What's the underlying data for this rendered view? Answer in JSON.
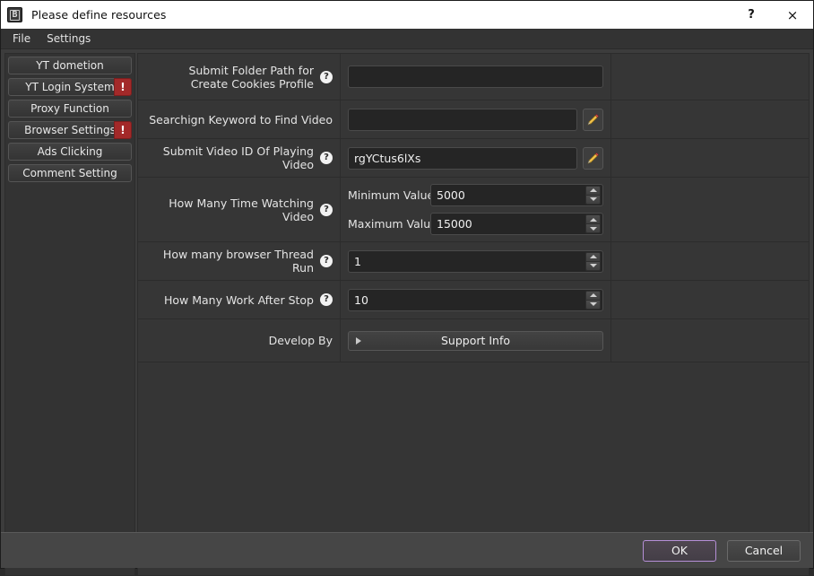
{
  "window": {
    "title": "Please define resources",
    "icon": "app-icon",
    "help_label": "?",
    "close_label": "×"
  },
  "menubar": {
    "items": [
      {
        "label": "File"
      },
      {
        "label": "Settings"
      }
    ]
  },
  "sidebar": {
    "items": [
      {
        "label": "YT dometion",
        "badge": ""
      },
      {
        "label": "YT Login System",
        "badge": "!"
      },
      {
        "label": "Proxy Function",
        "badge": ""
      },
      {
        "label": "Browser Settings",
        "badge": "!"
      },
      {
        "label": "Ads Clicking",
        "badge": ""
      },
      {
        "label": "Comment Setting",
        "badge": ""
      }
    ]
  },
  "form": {
    "rows": [
      {
        "label": "Submit Folder Path for Create Cookies Profile",
        "has_help": true,
        "value": "",
        "placeholder": "",
        "has_pencil": false
      },
      {
        "label": "Searchign Keyword to Find Video",
        "has_help": false,
        "value": "",
        "placeholder": "",
        "has_pencil": true
      },
      {
        "label": "Submit Video ID Of Playing Video",
        "has_help": true,
        "value": "rgYCtus6lXs",
        "placeholder": "",
        "has_pencil": true
      }
    ],
    "watch_time": {
      "label": "How Many Time Watching Video",
      "has_help": true,
      "min_label": "Minimum Value",
      "min_value": "5000",
      "max_label": "Maximum Value",
      "max_value": "15000"
    },
    "thread_run": {
      "label": "How many browser Thread Run",
      "has_help": true,
      "value": "1"
    },
    "work_after_stop": {
      "label": "How Many Work After Stop",
      "has_help": true,
      "value": "10"
    },
    "develop_by": {
      "label": "Develop By",
      "has_help": false,
      "button_label": "Support Info"
    }
  },
  "footer": {
    "ok_label": "OK",
    "cancel_label": "Cancel"
  },
  "colors": {
    "accent": "#b58fd6",
    "warning_badge": "#a32929",
    "window_bg": "#3c3c3c",
    "panel_bg": "#353535",
    "input_bg": "#252525",
    "titlebar_bg": "#ffffff",
    "pencil_body": "#f0c04a",
    "pencil_tip": "#e05a5a"
  }
}
